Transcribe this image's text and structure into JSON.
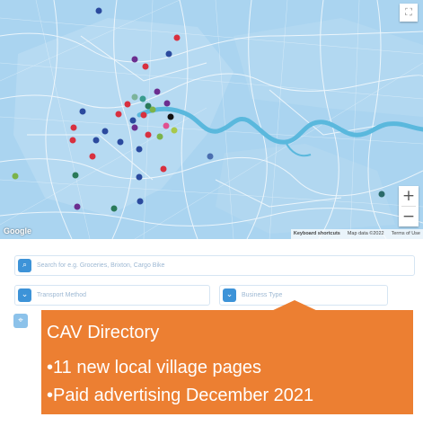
{
  "map": {
    "fullscreen_icon": "fullscreen-icon",
    "zoom_in": "+",
    "zoom_out": "−",
    "google_logo": "Google",
    "attribution": {
      "shortcuts": "Keyboard shortcuts",
      "map_data": "Map data ©2022",
      "terms": "Terms of Use"
    },
    "colors": {
      "water": "#a9d3ef",
      "river": "#58b6dc",
      "land": "#b9dcf2"
    },
    "markers": [
      {
        "color": "#2b4a9e"
      },
      {
        "color": "#2b4a9e"
      },
      {
        "color": "#d8303f"
      },
      {
        "color": "#6b2e8f"
      }
    ]
  },
  "search": {
    "placeholder": "Search for e.g. Groceries, Brixton, Cargo Bike",
    "icon": "search-icon"
  },
  "filters": {
    "transport": "Transport Method",
    "business": "Business Type",
    "icon": "chevron-down-icon"
  },
  "location_icon": "crosshair-icon",
  "callout": {
    "title": "CAV Directory",
    "bullets": [
      "•11 new local village pages",
      "•Paid advertising December 2021"
    ],
    "color": "#ec7f32"
  }
}
